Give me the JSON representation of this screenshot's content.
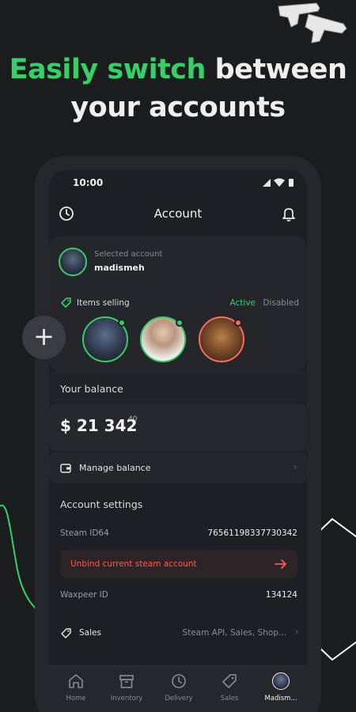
{
  "headline": {
    "green": "Easily switch",
    "white_1": "between",
    "white_2": "your accounts"
  },
  "status_bar": {
    "time": "10:00"
  },
  "app_bar": {
    "title": "Account"
  },
  "selected_account": {
    "caption": "Selected account",
    "name": "madismeh"
  },
  "items_selling": {
    "label": "Items selling",
    "active": "Active",
    "disabled": "Disabled"
  },
  "balance": {
    "label": "Your balance",
    "amount": "$ 21 342",
    "cents": "40"
  },
  "manage_balance": {
    "label": "Manage balance"
  },
  "account_settings": {
    "title": "Account settings",
    "steam_id_label": "Steam ID64",
    "steam_id_value": "76561198337730342",
    "unbind_label": "Unbind current steam account",
    "waxpeer_label": "Waxpeer ID",
    "waxpeer_value": "134124",
    "sales_label": "Sales",
    "sales_value": "Steam API, Sales, Shop..."
  },
  "add_button": {
    "symbol": "+"
  },
  "bottom_nav": [
    {
      "label": "Home"
    },
    {
      "label": "Inventory"
    },
    {
      "label": "Delivery"
    },
    {
      "label": "Sales"
    },
    {
      "label": "Madism..."
    }
  ],
  "colors": {
    "accent": "#35d068",
    "danger": "#ff5a4e",
    "background": "#1b1c1e"
  }
}
